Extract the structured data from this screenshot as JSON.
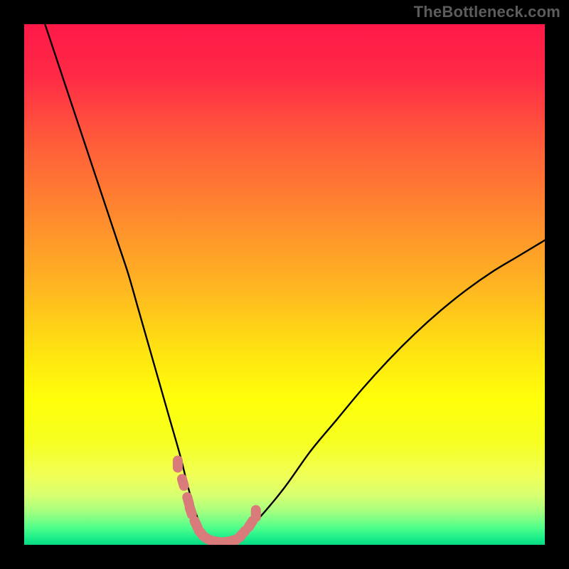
{
  "watermark": "TheBottleneck.com",
  "colors": {
    "frame_bg": "#000000",
    "curve_stroke": "#000000",
    "marker_fill": "#d97b7b",
    "marker_stroke": "#d97b7b",
    "gradient_stops": [
      {
        "offset": 0.0,
        "color": "#ff1948"
      },
      {
        "offset": 0.1,
        "color": "#ff2a46"
      },
      {
        "offset": 0.22,
        "color": "#ff5a3a"
      },
      {
        "offset": 0.35,
        "color": "#ff8430"
      },
      {
        "offset": 0.5,
        "color": "#ffb422"
      },
      {
        "offset": 0.62,
        "color": "#ffe012"
      },
      {
        "offset": 0.72,
        "color": "#ffff0a"
      },
      {
        "offset": 0.8,
        "color": "#f6ff20"
      },
      {
        "offset": 0.865,
        "color": "#f0ff55"
      },
      {
        "offset": 0.905,
        "color": "#d8ff70"
      },
      {
        "offset": 0.938,
        "color": "#a0ff80"
      },
      {
        "offset": 0.965,
        "color": "#55ff8a"
      },
      {
        "offset": 0.985,
        "color": "#20f08a"
      },
      {
        "offset": 1.0,
        "color": "#06d884"
      }
    ]
  },
  "chart_data": {
    "type": "line",
    "title": "",
    "xlabel": "",
    "ylabel": "",
    "xlim": [
      0,
      100
    ],
    "ylim": [
      0,
      100
    ],
    "grid": false,
    "legend": false,
    "series": [
      {
        "name": "bottleneck-curve",
        "x": [
          4,
          6,
          8,
          10,
          12,
          14,
          16,
          18,
          20,
          22,
          24,
          26,
          28,
          30,
          31.5,
          33,
          34.5,
          36,
          38,
          40,
          42,
          45,
          50,
          55,
          60,
          65,
          70,
          75,
          80,
          85,
          90,
          95,
          100
        ],
        "y": [
          100,
          94,
          88,
          82,
          76,
          70,
          64,
          58,
          52,
          45,
          38,
          31,
          24,
          17,
          11,
          6,
          2.5,
          0.8,
          0.5,
          0.8,
          2.2,
          5,
          11,
          18,
          24,
          30,
          35.5,
          40.5,
          45,
          49,
          52.5,
          55.5,
          58.5
        ]
      }
    ],
    "markers": {
      "name": "highlighted-range",
      "x": [
        29.5,
        30.5,
        31.5,
        32,
        33,
        34,
        35.5,
        37,
        38,
        39,
        40,
        41,
        42,
        43.5,
        44.5
      ],
      "y": [
        15.5,
        12,
        8.5,
        6.5,
        4,
        2.2,
        1,
        0.6,
        0.5,
        0.6,
        0.8,
        1.2,
        2.2,
        4,
        6
      ]
    }
  }
}
